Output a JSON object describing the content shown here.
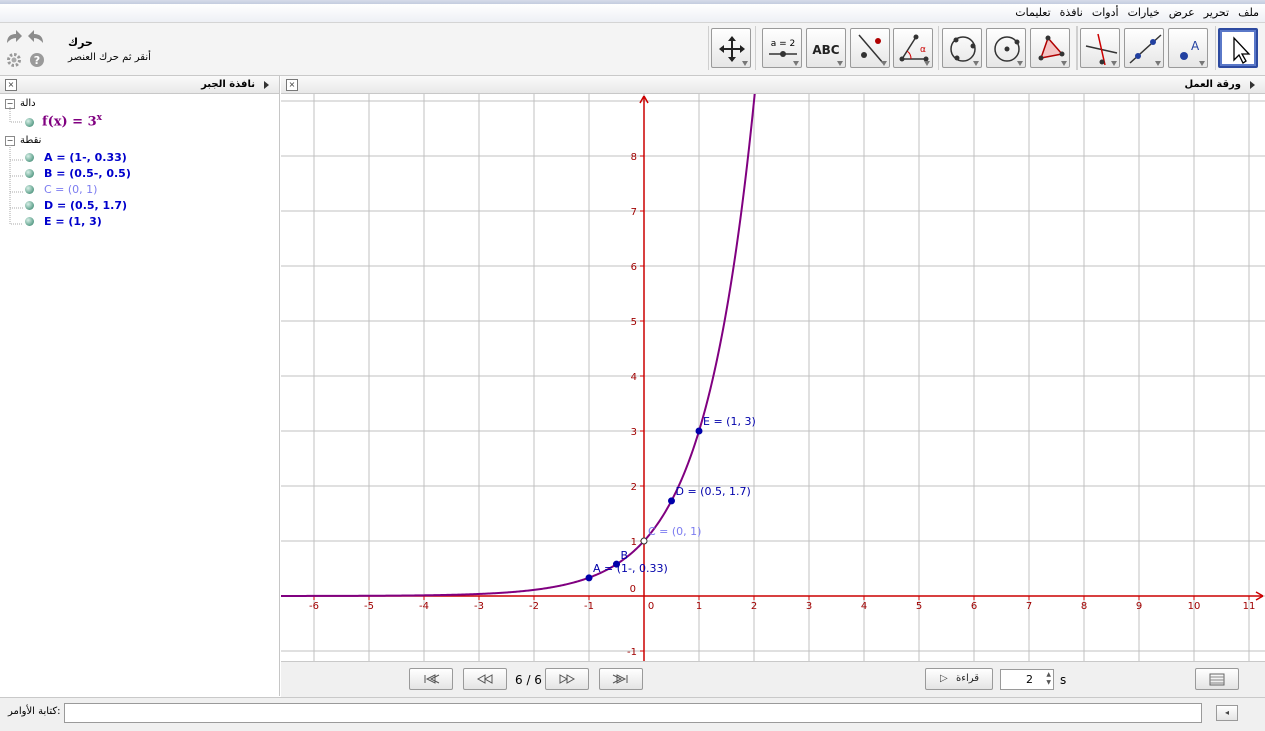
{
  "menu": [
    "ملف",
    "تحرير",
    "عرض",
    "خيارات",
    "أدوات",
    "نافذة",
    "تعليمات"
  ],
  "tool": {
    "name": "حرك",
    "help": "أنقر ثم حرك العنصر"
  },
  "toolbar_icons": [
    "move-tool",
    "move-graphics-view-tool",
    "slider-tool",
    "text-tool",
    "reflect-tool",
    "angle-tool",
    "circle-through-three-points-tool",
    "circle-with-center-tool",
    "polygon-tool",
    "perpendicular-line-tool",
    "line-tool",
    "point-tool",
    "selection-arrow-tool"
  ],
  "toolbar_labels": {
    "slider": "a = 2",
    "text": "ABC",
    "point": "A",
    "angle": "α"
  },
  "algebra": {
    "title": "نافذة الجبر",
    "groups": [
      {
        "label": "دالة",
        "items": [
          {
            "text": "f(x) = 3",
            "sup": "x",
            "color": "#800080"
          }
        ]
      },
      {
        "label": "نقطة",
        "items": [
          {
            "text": "A = (1-, 0.33)",
            "color": "#0000cc"
          },
          {
            "text": "B = (0.5-, 0.5)",
            "color": "#0000cc"
          },
          {
            "text": "C = (0, 1)",
            "color": "#7c7cf0"
          },
          {
            "text": "D = (0.5, 1.7)",
            "color": "#0000cc"
          },
          {
            "text": "E = (1, 3)",
            "color": "#0000cc"
          }
        ]
      }
    ]
  },
  "graphics": {
    "title": "ورقة العمل",
    "x_ticks": [
      -6,
      -5,
      -4,
      -3,
      -2,
      -1,
      0,
      1,
      2,
      3,
      4,
      5,
      6,
      7,
      8,
      9,
      10,
      11
    ],
    "y_ticks": [
      -1,
      0,
      1,
      2,
      3,
      4,
      5,
      6,
      7,
      8
    ],
    "function": {
      "expr": "3^x",
      "color": "#800080"
    },
    "points": [
      {
        "name": "A",
        "x": -1,
        "y": 0.33,
        "label": "A = (1-, 0.33)",
        "color": "#0000aa"
      },
      {
        "name": "B",
        "x": -0.5,
        "y": 0.58,
        "label": "B",
        "color": "#0000aa"
      },
      {
        "name": "C",
        "x": 0,
        "y": 1,
        "label": "C = (0, 1)",
        "color": "#7c7cf0"
      },
      {
        "name": "D",
        "x": 0.5,
        "y": 1.73,
        "label": "D = (0.5, 1.7)",
        "color": "#0000aa"
      },
      {
        "name": "E",
        "x": 1,
        "y": 3,
        "label": "E = (1, 3)",
        "color": "#0000aa"
      }
    ]
  },
  "animation": {
    "step": "6 / 6",
    "play_label": "قراءة",
    "speed": "2",
    "unit": "s"
  },
  "command": {
    "label": "كتابة الأوامر:",
    "value": ""
  }
}
